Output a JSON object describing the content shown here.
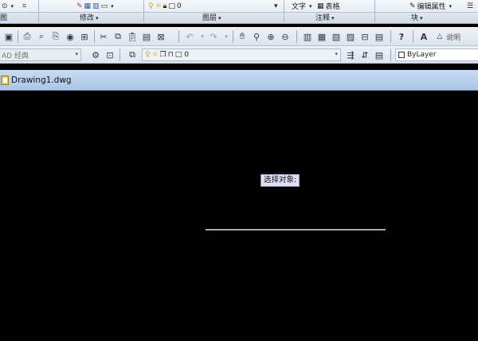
{
  "ribbon": {
    "top_items": {
      "layer_value": "0",
      "text_label": "文字",
      "table_label": "表格",
      "edit_attr_label": "编辑属性"
    },
    "panels": [
      {
        "label": "图"
      },
      {
        "label": "修改"
      },
      {
        "label": "图层"
      },
      {
        "label": "注释"
      },
      {
        "label": "块"
      }
    ]
  },
  "toolbar1": {
    "description_label": "说明"
  },
  "toolbar2": {
    "workspace": "AD 经典",
    "layer_value": "0",
    "color_value": "ByLayer"
  },
  "document": {
    "tab_title": "Drawing1.dwg"
  },
  "canvas": {
    "prompt": "选择对象:"
  }
}
